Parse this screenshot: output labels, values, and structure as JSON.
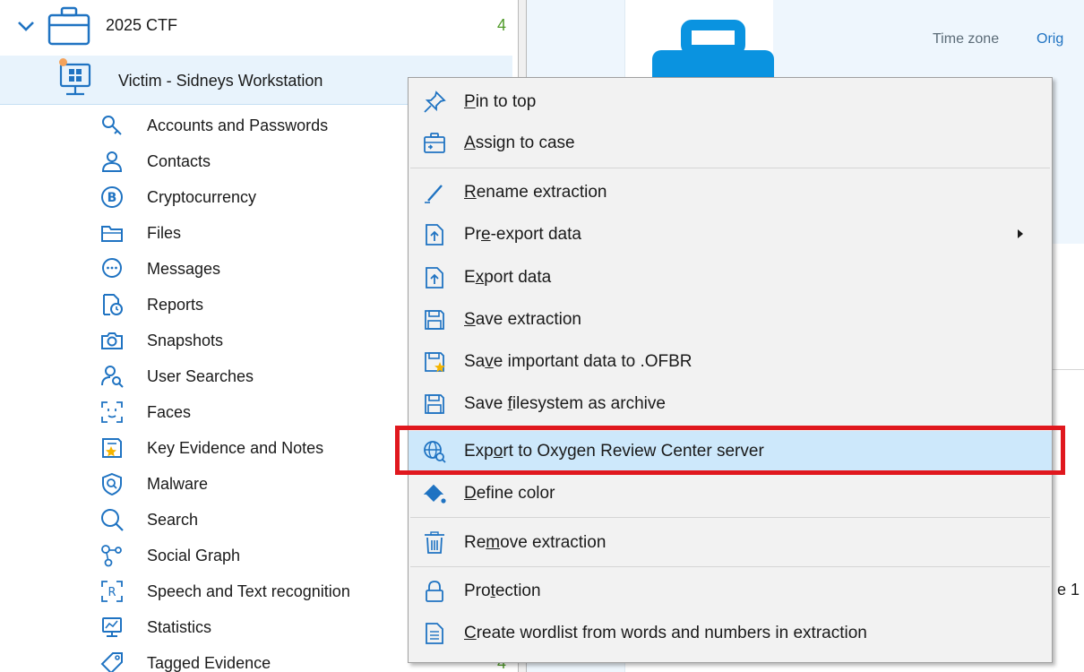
{
  "tree": {
    "case": {
      "label": "2025 CTF",
      "count": "4"
    },
    "victim": {
      "label": "Victim - Sidneys Workstation"
    },
    "items": [
      {
        "label": "Accounts and Passwords",
        "icon": "key-icon"
      },
      {
        "label": "Contacts",
        "icon": "person-icon"
      },
      {
        "label": "Cryptocurrency",
        "icon": "bitcoin-icon"
      },
      {
        "label": "Files",
        "icon": "folder-icon"
      },
      {
        "label": "Messages",
        "icon": "chat-bubble-icon"
      },
      {
        "label": "Reports",
        "icon": "report-clock-icon"
      },
      {
        "label": "Snapshots",
        "icon": "camera-icon"
      },
      {
        "label": "User Searches",
        "icon": "person-search-icon"
      },
      {
        "label": "Faces",
        "icon": "face-scan-icon"
      },
      {
        "label": "Key Evidence and Notes",
        "icon": "note-star-icon"
      },
      {
        "label": "Malware",
        "icon": "shield-search-icon"
      },
      {
        "label": "Search",
        "icon": "magnifier-icon"
      },
      {
        "label": "Social Graph",
        "icon": "graph-nodes-icon"
      },
      {
        "label": "Speech and Text recognition",
        "icon": "text-recognition-icon"
      },
      {
        "label": "Statistics",
        "icon": "chart-monitor-icon"
      },
      {
        "label": "Tagged Evidence",
        "icon": "tag-icon",
        "count": "4"
      }
    ]
  },
  "right_panel": {
    "time_zone_label": "Time zone",
    "orig_label": "Orig",
    "partial_text": "e 1"
  },
  "context_menu": {
    "items": [
      {
        "pre": "",
        "u": "P",
        "post": "in to top",
        "icon": "pin-icon"
      },
      {
        "pre": "",
        "u": "A",
        "post": "ssign to case",
        "icon": "briefcase-arrow-icon"
      },
      {
        "pre": "",
        "u": "R",
        "post": "ename extraction",
        "icon": "pencil-icon"
      },
      {
        "pre": "Pr",
        "u": "e",
        "post": "-export data",
        "icon": "export-doc-icon",
        "submenu": true
      },
      {
        "pre": "E",
        "u": "x",
        "post": "port data",
        "icon": "export-doc-icon"
      },
      {
        "pre": "",
        "u": "S",
        "post": "ave extraction",
        "icon": "floppy-icon"
      },
      {
        "pre": "Sa",
        "u": "v",
        "post": "e important data to .OFBR",
        "icon": "floppy-star-icon"
      },
      {
        "pre": "Save ",
        "u": "f",
        "post": "ilesystem as archive",
        "icon": "floppy-icon"
      },
      {
        "pre": "Exp",
        "u": "o",
        "post": "rt to Oxygen Review Center server",
        "icon": "globe-search-icon"
      },
      {
        "pre": "",
        "u": "D",
        "post": "efine color",
        "icon": "paint-bucket-icon"
      },
      {
        "pre": "Re",
        "u": "m",
        "post": "ove extraction",
        "icon": "trash-icon"
      },
      {
        "pre": "Pro",
        "u": "t",
        "post": "ection",
        "icon": "lock-icon"
      },
      {
        "pre": "",
        "u": "C",
        "post": "reate wordlist from words and numbers in extraction",
        "icon": "wordlist-doc-icon"
      }
    ]
  },
  "colors": {
    "accent": "#1f73c2",
    "highlight_box": "#e0181e",
    "count_green": "#4f9a28",
    "menu_hover": "#cde8fb"
  }
}
